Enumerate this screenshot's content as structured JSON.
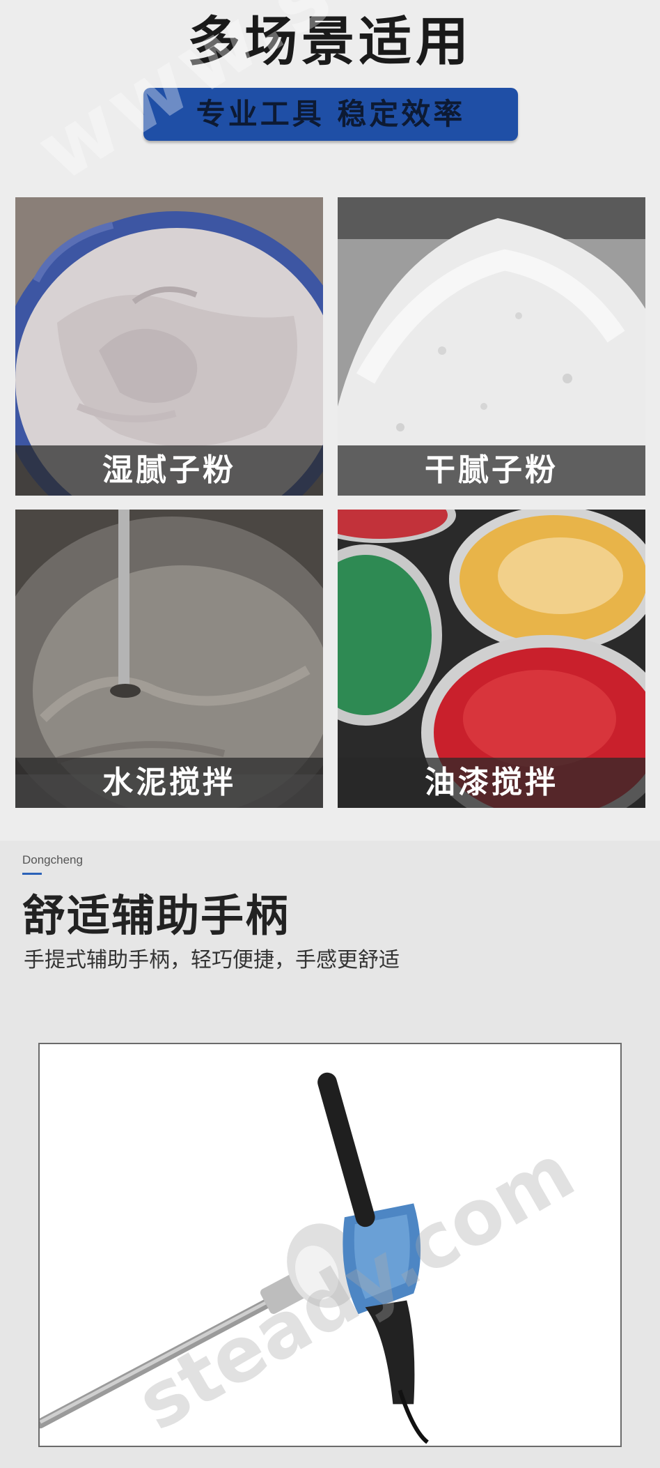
{
  "header": {
    "title": "多场景适用",
    "tagline": "专业工具 稳定效率"
  },
  "scenarios": [
    {
      "label": "湿腻子粉",
      "icon": "wet-putty-image"
    },
    {
      "label": "干腻子粉",
      "icon": "dry-putty-powder-image"
    },
    {
      "label": "水泥搅拌",
      "icon": "cement-mixing-image"
    },
    {
      "label": "油漆搅拌",
      "icon": "paint-cans-image"
    }
  ],
  "handle_section": {
    "brand": "Dongcheng",
    "title": "舒适辅助手柄",
    "subtitle": "手提式辅助手柄，轻巧便捷，手感更舒适"
  },
  "watermark": {
    "text": "www.steady.com"
  },
  "colors": {
    "accent_blue": "#1f4fa6",
    "caption_overlay": "#282828",
    "tool_blue": "#4d86c4"
  }
}
